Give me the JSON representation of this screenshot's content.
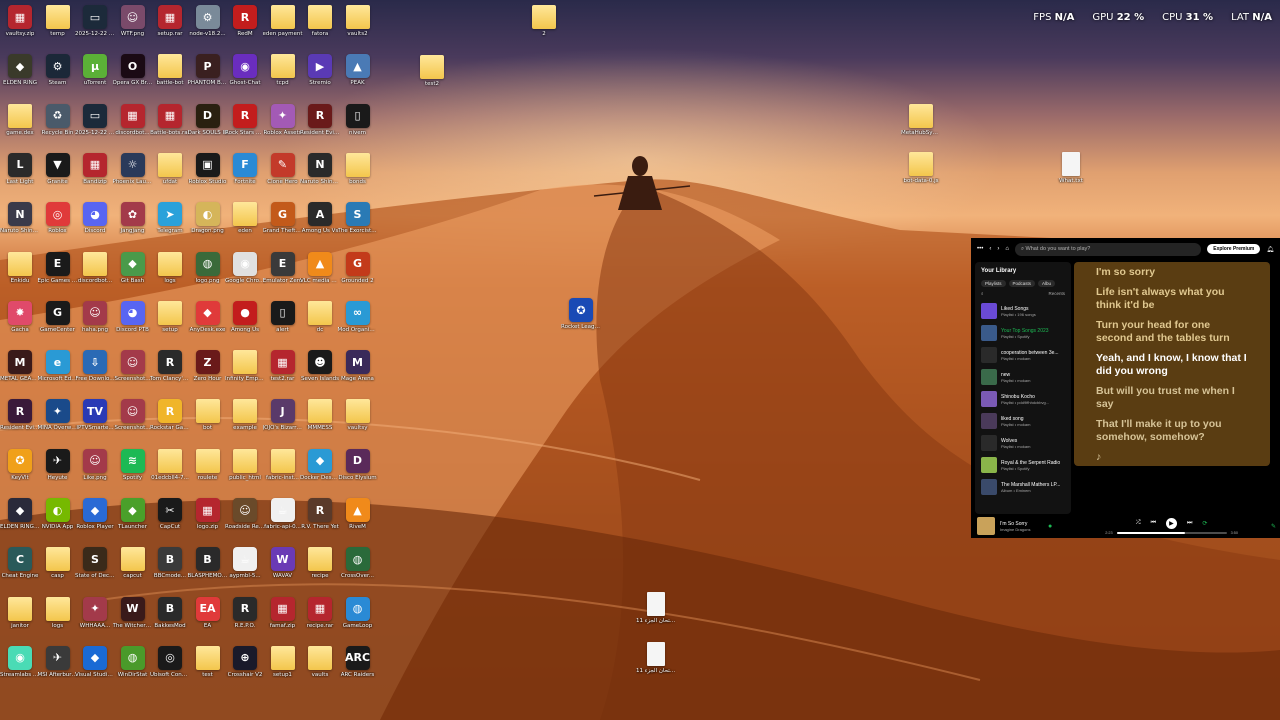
{
  "hud": {
    "fps_label": "FPS",
    "fps": "N/A",
    "gpu_label": "GPU",
    "gpu": "22 %",
    "cpu_label": "CPU",
    "cpu": "31 %",
    "lat_label": "LAT",
    "lat": "N/A"
  },
  "icons": [
    {
      "label": "vaultsy.zip",
      "color": "#b5262e",
      "ch": "▦"
    },
    {
      "label": "temp",
      "color": "",
      "ch": ""
    },
    {
      "label": "2025-12-22 18-51-30...",
      "color": "#1c2a3a",
      "ch": "▭"
    },
    {
      "label": "WTF.png",
      "color": "#7a4a6a",
      "ch": "☺"
    },
    {
      "label": "setup.rar",
      "color": "#b5262e",
      "ch": "▦"
    },
    {
      "label": "node-v18.2...",
      "color": "#7a8a99",
      "ch": "⚙"
    },
    {
      "label": "RedM",
      "color": "#c31d1d",
      "ch": "R"
    },
    {
      "label": "eden payment",
      "color": "",
      "ch": ""
    },
    {
      "label": "fatora",
      "color": "",
      "ch": ""
    },
    {
      "label": "vaults2",
      "color": "",
      "ch": ""
    },
    {
      "label": "ELDEN RING",
      "color": "#3a3a2a",
      "ch": "◆"
    },
    {
      "label": "Steam",
      "color": "#1b2838",
      "ch": "⚙"
    },
    {
      "label": "uTorrent",
      "color": "#5bb037",
      "ch": "µ"
    },
    {
      "label": "Opera GX Browser",
      "color": "#1a0a14",
      "ch": "O"
    },
    {
      "label": "battle-bot",
      "color": "",
      "ch": ""
    },
    {
      "label": "PHANTOM BLADE",
      "color": "#3a2020",
      "ch": "P"
    },
    {
      "label": "Ghost-Chat",
      "color": "#6a2dbf",
      "ch": "◉"
    },
    {
      "label": "tcpd",
      "color": "",
      "ch": ""
    },
    {
      "label": "Stremio",
      "color": "#5a3ab5",
      "ch": "▶"
    },
    {
      "label": "PEAK",
      "color": "#4a7ab5",
      "ch": "▲"
    },
    {
      "label": "game.dex",
      "color": "",
      "ch": ""
    },
    {
      "label": "Recycle Bin",
      "color": "#4a5a6a",
      "ch": "♻"
    },
    {
      "label": "2025-12-22 18-48-33...",
      "color": "#1c2a3a",
      "ch": "▭"
    },
    {
      "label": "discordbot...",
      "color": "#b5262e",
      "ch": "▦"
    },
    {
      "label": "Battle-bots.rar",
      "color": "#b5262e",
      "ch": "▦"
    },
    {
      "label": "Dark SOULS III",
      "color": "#2a2010",
      "ch": "D"
    },
    {
      "label": "Rock Stars Destination",
      "color": "#c31d1d",
      "ch": "R"
    },
    {
      "label": "Roblox Assets",
      "color": "#a35ab5",
      "ch": "✦"
    },
    {
      "label": "Resident Evil 4",
      "color": "#6a1a1a",
      "ch": "R"
    },
    {
      "label": "nivem",
      "color": "#1a1a1a",
      "ch": "▯"
    },
    {
      "label": "Last Light",
      "color": "#2a2a2a",
      "ch": "L"
    },
    {
      "label": "Granite",
      "color": "#1a1a1a",
      "ch": "▼"
    },
    {
      "label": "Bandizip",
      "color": "#b5262e",
      "ch": "▦"
    },
    {
      "label": "Phoenix Launcher v2",
      "color": "#2a3a5a",
      "ch": "☼"
    },
    {
      "label": "ufdat",
      "color": "",
      "ch": ""
    },
    {
      "label": "Roblox Studio",
      "color": "#1a1a1a",
      "ch": "▣"
    },
    {
      "label": "Fortnite",
      "color": "#2a8ad5",
      "ch": "F"
    },
    {
      "label": "Clone Hero",
      "color": "#c33a2a",
      "ch": "✎"
    },
    {
      "label": "Naruto Shinobi",
      "color": "#2a2a2a",
      "ch": "N"
    },
    {
      "label": "bonds",
      "color": "",
      "ch": ""
    },
    {
      "label": "Naruto Shinobi...",
      "color": "#3a3a4a",
      "ch": "N"
    },
    {
      "label": "Roblox",
      "color": "#e03a3a",
      "ch": "◎"
    },
    {
      "label": "Discord",
      "color": "#5865f2",
      "ch": "◕"
    },
    {
      "label": "Jangjang",
      "color": "#a33a4a",
      "ch": "✿"
    },
    {
      "label": "Telegram",
      "color": "#2aa1da",
      "ch": "➤"
    },
    {
      "label": "Dragon.png",
      "color": "#d5b55a",
      "ch": "◐"
    },
    {
      "label": "eden",
      "color": "",
      "ch": ""
    },
    {
      "label": "Grand Theft Roleplay",
      "color": "#c35a1a",
      "ch": "G"
    },
    {
      "label": "Among Us Vs",
      "color": "#2a2a2a",
      "ch": "A"
    },
    {
      "label": "The Exorcist: Legion",
      "color": "#2a7ab5",
      "ch": "S"
    },
    {
      "label": "Enkidu",
      "color": "",
      "ch": ""
    },
    {
      "label": "Epic Games Launcher",
      "color": "#1a1a1a",
      "ch": "E"
    },
    {
      "label": "discordbot...",
      "color": "",
      "ch": ""
    },
    {
      "label": "Git Bash",
      "color": "#4a9a4a",
      "ch": "◆"
    },
    {
      "label": "logs",
      "color": "",
      "ch": ""
    },
    {
      "label": "logo.png",
      "color": "#3a6a3a",
      "ch": "◍"
    },
    {
      "label": "Google Chrome",
      "color": "#e0e0e0",
      "ch": "◉"
    },
    {
      "label": "Emulator Zero",
      "color": "#3a3a3a",
      "ch": "E"
    },
    {
      "label": "VLC media player",
      "color": "#f08a1a",
      "ch": "▲"
    },
    {
      "label": "Grounded 2",
      "color": "#c33a1a",
      "ch": "G"
    },
    {
      "label": "Gacha",
      "color": "#e04a6a",
      "ch": "✸"
    },
    {
      "label": "GameCenter",
      "color": "#1a1a1a",
      "ch": "G"
    },
    {
      "label": "haha.png",
      "color": "#a33a4a",
      "ch": "☺"
    },
    {
      "label": "Discord PTB",
      "color": "#5865f2",
      "ch": "◕"
    },
    {
      "label": "setup",
      "color": "",
      "ch": ""
    },
    {
      "label": "AnyDesk.exe",
      "color": "#e03a3a",
      "ch": "◆"
    },
    {
      "label": "Among Us",
      "color": "#c31d1d",
      "ch": "●"
    },
    {
      "label": "alert",
      "color": "#1a1a1a",
      "ch": "▯"
    },
    {
      "label": "dc",
      "color": "",
      "ch": ""
    },
    {
      "label": "Mod Organizer",
      "color": "#2a9ad5",
      "ch": "∞"
    },
    {
      "label": "METAL GEAR SOLID V...",
      "color": "#3a1a1a",
      "ch": "M"
    },
    {
      "label": "Microsoft Edge",
      "color": "#2a9ad5",
      "ch": "e"
    },
    {
      "label": "Free Downlo...",
      "color": "#2a6ab5",
      "ch": "⇩"
    },
    {
      "label": "Screenshot...",
      "color": "#a33a4a",
      "ch": "☺"
    },
    {
      "label": "Tom Clancy's Rainbow S...",
      "color": "#2a2a2a",
      "ch": "R"
    },
    {
      "label": "Zero Hour",
      "color": "#6a1a1a",
      "ch": "Z"
    },
    {
      "label": "Infinity Empires",
      "color": "",
      "ch": ""
    },
    {
      "label": "test2.rar",
      "color": "#b5262e",
      "ch": "▦"
    },
    {
      "label": "Seven Islands",
      "color": "#1a1a1a",
      "ch": "☻"
    },
    {
      "label": "Mage Arena",
      "color": "#3a2a5a",
      "ch": "M"
    },
    {
      "label": "Resident Evil 3",
      "color": "#3a1a3a",
      "ch": "R"
    },
    {
      "label": "MINA Overwatch...",
      "color": "#1a4a8a",
      "ch": "✦"
    },
    {
      "label": "IPTVSmarte...",
      "color": "#2a3ab5",
      "ch": "TV"
    },
    {
      "label": "Screenshot...",
      "color": "#a33a4a",
      "ch": "☺"
    },
    {
      "label": "Rockstar Games...",
      "color": "#f0b52a",
      "ch": "R"
    },
    {
      "label": "bot",
      "color": "",
      "ch": ""
    },
    {
      "label": "example",
      "color": "",
      "ch": ""
    },
    {
      "label": "JOJO's Bizarre Ad...",
      "color": "#5a3a6a",
      "ch": "J"
    },
    {
      "label": "MMMESS",
      "color": "",
      "ch": ""
    },
    {
      "label": "vaultsy",
      "color": "",
      "ch": ""
    },
    {
      "label": "KeyVlt",
      "color": "#f0a01a",
      "ch": "✪"
    },
    {
      "label": "Heyute",
      "color": "#1a1a1a",
      "ch": "✈"
    },
    {
      "label": "Like.png",
      "color": "#a33a4a",
      "ch": "☺"
    },
    {
      "label": "Spotify",
      "color": "#1db954",
      "ch": "≋"
    },
    {
      "label": "01edcbll4-7...",
      "color": "",
      "ch": ""
    },
    {
      "label": "roulete",
      "color": "",
      "ch": ""
    },
    {
      "label": "public_html",
      "color": "",
      "ch": ""
    },
    {
      "label": "fabric-inst...",
      "color": "",
      "ch": ""
    },
    {
      "label": "Docker Desktop",
      "color": "#2a9ad5",
      "ch": "◆"
    },
    {
      "label": "Disco Elysium",
      "color": "#5a2a5a",
      "ch": "D"
    },
    {
      "label": "ELDEN RING NIGHTREIGN",
      "color": "#2a2a3a",
      "ch": "◆"
    },
    {
      "label": "NVIDIA App",
      "color": "#76b900",
      "ch": "◐"
    },
    {
      "label": "Roblox Player",
      "color": "#2a6ad5",
      "ch": "◆"
    },
    {
      "label": "TLauncher",
      "color": "#4aa02a",
      "ch": "◆"
    },
    {
      "label": "CapCut",
      "color": "#1a1a1a",
      "ch": "✂"
    },
    {
      "label": "logo.zip",
      "color": "#b5262e",
      "ch": "▦"
    },
    {
      "label": "Roadside Research",
      "color": "#6a4a2a",
      "ch": "☺"
    },
    {
      "label": "fabric-api-0...",
      "color": "#f0f0f0",
      "ch": "☕"
    },
    {
      "label": "R.V. There Yet",
      "color": "#5a3a2a",
      "ch": "R"
    },
    {
      "label": "RiveM",
      "color": "#f08a1a",
      "ch": "▲"
    },
    {
      "label": "Cheat Engine",
      "color": "#2a5a5a",
      "ch": "C"
    },
    {
      "label": "casp",
      "color": "",
      "ch": ""
    },
    {
      "label": "State of Decay 2",
      "color": "#3a2a1a",
      "ch": "S"
    },
    {
      "label": "capcut",
      "color": "",
      "ch": ""
    },
    {
      "label": "BBCmode...",
      "color": "#3a3a3a",
      "ch": "B"
    },
    {
      "label": "BLASPHEMOUS PC",
      "color": "#2a2a2a",
      "ch": "B"
    },
    {
      "label": "aypmbl-5...",
      "color": "#f0f0f0",
      "ch": "☕"
    },
    {
      "label": "WAVAV",
      "color": "#6a3ab5",
      "ch": "W"
    },
    {
      "label": "recipe",
      "color": "",
      "ch": ""
    },
    {
      "label": "CrossOver...",
      "color": "#2a6a3a",
      "ch": "◍"
    },
    {
      "label": "janitor",
      "color": "",
      "ch": ""
    },
    {
      "label": "logs",
      "color": "",
      "ch": ""
    },
    {
      "label": "WHHAAA...",
      "color": "#a33a4a",
      "ch": "✦"
    },
    {
      "label": "The Witcher 3 Wild Hunt",
      "color": "#3a1a1a",
      "ch": "W"
    },
    {
      "label": "BakkesMod",
      "color": "#2a2a2a",
      "ch": "B"
    },
    {
      "label": "EA",
      "color": "#e03a3a",
      "ch": "EA"
    },
    {
      "label": "R.E.P.O.",
      "color": "#2a2a2a",
      "ch": "R"
    },
    {
      "label": "famaf.zip",
      "color": "#b5262e",
      "ch": "▦"
    },
    {
      "label": "recipe.rar",
      "color": "#b5262e",
      "ch": "▦"
    },
    {
      "label": "GameLoop",
      "color": "#2a8ad5",
      "ch": "◍"
    },
    {
      "label": "Streamlabs Desktop",
      "color": "#4adbb5",
      "ch": "◉"
    },
    {
      "label": "MSI Afterburner",
      "color": "#3a3a3a",
      "ch": "✈"
    },
    {
      "label": "Visual Studio Code",
      "color": "#1a6ad5",
      "ch": "◆"
    },
    {
      "label": "WinDirStat",
      "color": "#4a9a2a",
      "ch": "◍"
    },
    {
      "label": "Ubisoft Connect",
      "color": "#1a1a1a",
      "ch": "◎"
    },
    {
      "label": "test",
      "color": "",
      "ch": ""
    },
    {
      "label": "Crosshair V2",
      "color": "#1a1a2a",
      "ch": "⊕"
    },
    {
      "label": "setup1",
      "color": "",
      "ch": ""
    },
    {
      "label": "vaults",
      "color": "",
      "ch": ""
    },
    {
      "label": "ARC Raiders",
      "color": "#1a1a1a",
      "ch": "ARC"
    }
  ],
  "loose_icons": [
    {
      "label": "2",
      "type": "folder"
    },
    {
      "label": "test2",
      "type": "folder"
    },
    {
      "label": "Rocket League®",
      "type": "app",
      "color": "#1a4ab5",
      "ch": "✪"
    },
    {
      "label": "MetaHubSync...",
      "type": "folder"
    },
    {
      "label": "bot-data-0.js",
      "type": "folder"
    },
    {
      "label": "What.txt",
      "type": "doc"
    },
    {
      "label": "امتحان الجزء 11 Aaqa .........",
      "type": "doc"
    },
    {
      "label": "امتحان الجزء 11 Aaqa .........",
      "type": "doc"
    }
  ],
  "spotify": {
    "search_placeholder": "What do you want to play?",
    "explore_premium": "Explore Premium",
    "library_title": "Your Library",
    "chips": [
      "Playlists",
      "Podcasts",
      "Albu"
    ],
    "recents": "Recents",
    "playlists": [
      {
        "title": "Liked Songs",
        "sub": "Playlist • 196 songs",
        "color": "#6a4ad5",
        "active": false
      },
      {
        "title": "Your Top Songs 2023",
        "sub": "Playlist • Spotify",
        "color": "#3a5a8a",
        "active": true
      },
      {
        "title": "cooperation between 3e...",
        "sub": "Playlist • mokam",
        "color": "#2a2a2a",
        "active": false
      },
      {
        "title": "new",
        "sub": "Playlist • mokam",
        "color": "#3a6a4a",
        "active": false
      },
      {
        "title": "Shinobu Kocho",
        "sub": "Playlist • pdd9ffhhdcbbvg...",
        "color": "#7a5ab5",
        "active": false
      },
      {
        "title": "liked song",
        "sub": "Playlist • mokam",
        "color": "#4a3a5a",
        "active": false
      },
      {
        "title": "Wolves",
        "sub": "Playlist • mokam",
        "color": "#2a2a2a",
        "active": false
      },
      {
        "title": "Royal & the Serpent Radio",
        "sub": "Playlist • Spotify",
        "color": "#8ab54a",
        "active": false
      },
      {
        "title": "The Marshall Mathers LP...",
        "sub": "Album • Eminem",
        "color": "#3a4a6a",
        "active": false
      }
    ],
    "lyrics": [
      {
        "text": "I'm so sorry",
        "state": "past"
      },
      {
        "text": "Life isn't always what you think it'd be",
        "state": "past"
      },
      {
        "text": "Turn your head for one second and the tables turn",
        "state": "past"
      },
      {
        "text": "Yeah, and I know, I know that I did you wrong",
        "state": "now"
      },
      {
        "text": "But will you trust me when I say",
        "state": "fut"
      },
      {
        "text": "That I'll make it up to you somehow, somehow?",
        "state": "fut"
      },
      {
        "text": "♪",
        "state": "fut"
      }
    ],
    "now_playing": {
      "title": "I'm So Sorry",
      "artist": "Imagine Dragons",
      "elapsed": "2:23",
      "duration": "3:50",
      "progress": 0.62
    }
  }
}
